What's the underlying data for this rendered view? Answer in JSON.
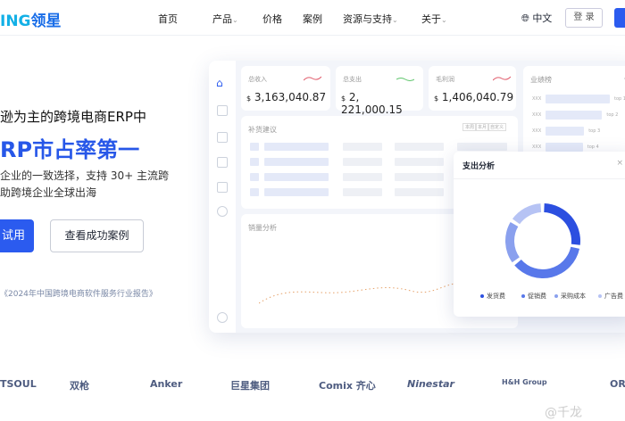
{
  "nav": {
    "logo_a": "ING",
    "logo_b": "领星",
    "items": [
      "首页",
      "产品",
      "价格",
      "案例",
      "资源与支持",
      "关于"
    ],
    "lang": "中文",
    "login": "登 录"
  },
  "hero": {
    "line1": "逊为主的跨境电商ERP中",
    "line2": "RP市占率第一",
    "line3": "企业的一致选择，支持 30+ 主流跨",
    "line4": "助跨境企业全球出海",
    "trial": "试用",
    "cases": "查看成功案例",
    "report": "《2024年中国跨境电商软件服务行业报告》"
  },
  "dashboard": {
    "stats": [
      {
        "label": "总收入",
        "currency": "$",
        "value": "3,163,040.87",
        "trend_color": "#e05a6a"
      },
      {
        "label": "总支出",
        "currency": "$",
        "value": "2, 221,000.15",
        "trend_color": "#5cc46a"
      },
      {
        "label": "毛利润",
        "currency": "$",
        "value": "1,406,040.79",
        "trend_color": "#e05a6a"
      }
    ],
    "ranking": {
      "title": "业绩榜",
      "more": "···",
      "rows": [
        {
          "name": "XXX",
          "tag": "top 1",
          "level": 1
        },
        {
          "name": "XXX",
          "tag": "top 2",
          "level": 0.88
        },
        {
          "name": "XXX",
          "tag": "top 3",
          "level": 0.6
        },
        {
          "name": "XXX",
          "tag": "top 4",
          "level": 0.58
        }
      ]
    },
    "restock": {
      "title": "补货建议",
      "filters": [
        "本周",
        "本月",
        "自定义"
      ]
    },
    "sales": {
      "title": "销量分析"
    },
    "expense": {
      "title": "支出分析",
      "close": "×"
    }
  },
  "chart_data": {
    "type": "pie",
    "series": [
      {
        "name": "发货费",
        "value": 26,
        "color": "#2c4fe0"
      },
      {
        "name": "促销费",
        "value": 35,
        "color": "#5878ea"
      },
      {
        "name": "采购成本",
        "value": 18,
        "color": "#8aa0ee"
      },
      {
        "name": "广告费",
        "value": 14,
        "color": "#b6c3f4"
      }
    ]
  },
  "brands": [
    "TSOUL",
    "双枪",
    "Anker",
    "巨星集团",
    "Comix 齐心",
    "Ninestar",
    "H&H Group",
    "ORI"
  ],
  "watermark": "@千龙"
}
